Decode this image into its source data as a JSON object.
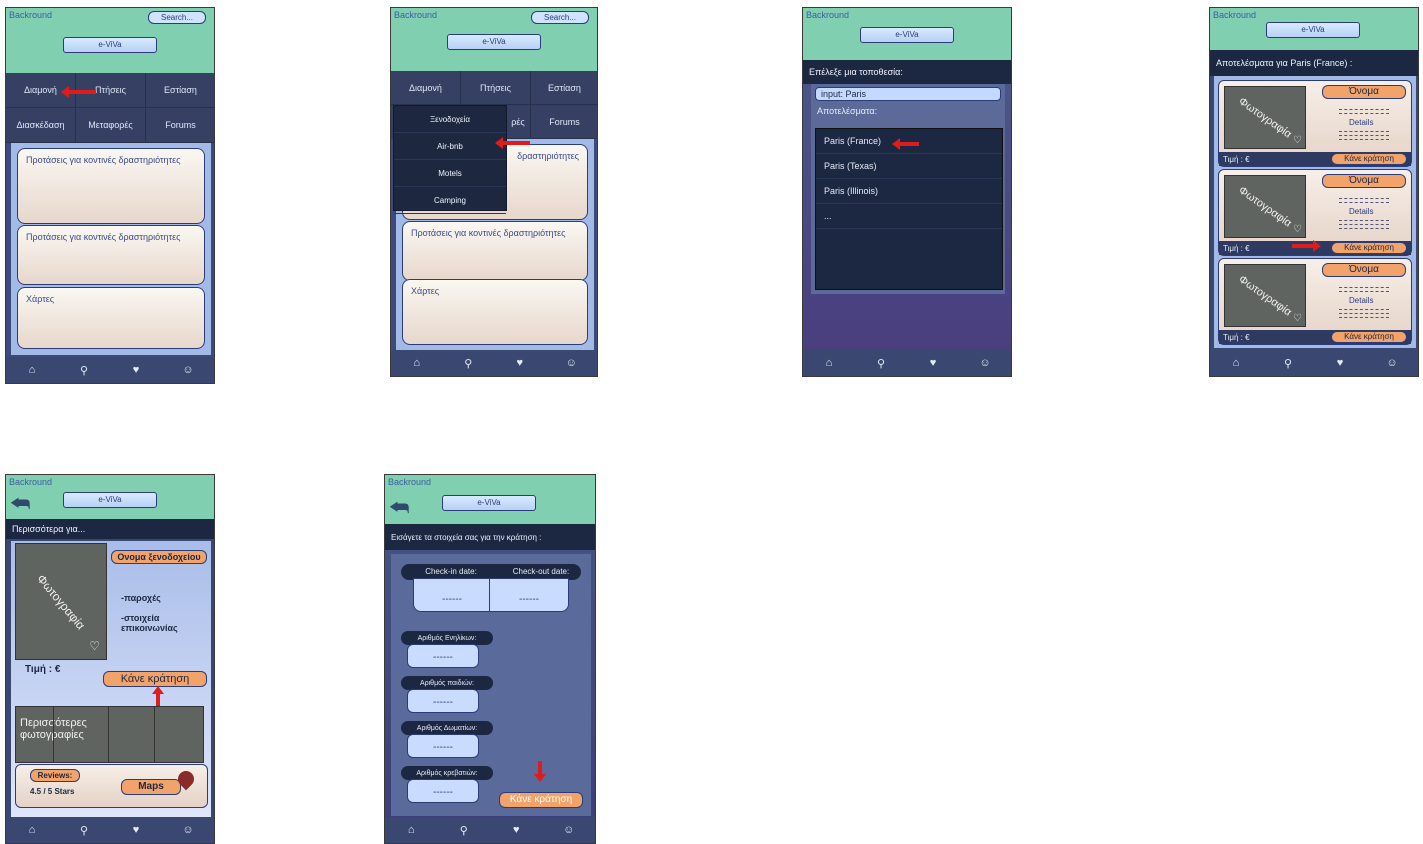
{
  "common": {
    "backround": "Backround",
    "search": "Search...",
    "logo": "e-ViVa",
    "nav_icons": [
      "home-icon",
      "search-icon",
      "heart-icon",
      "user-icon"
    ]
  },
  "screen1": {
    "nav": [
      "Διαμονή",
      "Πτήσεις",
      "Εστίαση",
      "Διασκέδαση",
      "Μεταφορές",
      "Forums"
    ],
    "cards": [
      "Προτάσεις για κοντινές δραστηριότητες",
      "Προτάσεις για κοντινές δραστηριότητες",
      "Χάρτες"
    ]
  },
  "screen2": {
    "nav": [
      "Διαμονή",
      "Πτήσεις",
      "Εστίαση",
      "Διασκέδαση",
      "Μεταφορές",
      "Forums"
    ],
    "menu": [
      "Ξενοδοχεία",
      "Air-bnb",
      "Motels",
      "Camping"
    ],
    "cards": [
      "Προτάσεις για κοντινές δραστηριότητες",
      "Προτάσεις για κοντινές δραστηριότητες",
      "Χάρτες"
    ],
    "partial_label": "δραστηριότητες",
    "partial_nav": "ρές"
  },
  "screen3": {
    "header": "Επέλεξε μια τοποθεσία:",
    "input": "input: Paris",
    "results_label": "Αποτελέσματα:",
    "results": [
      "Paris (France)",
      "Paris (Texas)",
      "Paris (Illinois)",
      "..."
    ]
  },
  "screen4": {
    "header": "Αποτελέσματα για Paris (France) :",
    "photo": "Φωτογραφία",
    "name": "Όνομα",
    "details": "Details",
    "price": "Τιμή : €",
    "book": "Κάνε κράτηση"
  },
  "screen5": {
    "header": "Περισσότερα για...",
    "photo": "Φωτογραφία",
    "hotel_name": "Ονομα ξενοδοχείου",
    "amenities": "-παροχές",
    "contact": "-στοιχεία επικοινωνίας",
    "price": "Τιμή : €",
    "book": "Κάνε κράτηση",
    "more_photos": "Περισσότερες φωτογραφίες",
    "reviews": "Reviews:",
    "stars": "4.5 / 5 Stars",
    "maps": "Maps"
  },
  "screen6": {
    "header": "Εισάγετε τα στοιχεία σας για την κράτηση :",
    "checkin": "Check-in date:",
    "checkout": "Check-out date:",
    "dashes": "------",
    "adults": "Αριθμός Ενηλίκων:",
    "children": "Αριθμός παιδιών:",
    "rooms": "Αριθμός Δωματίων:",
    "beds": "Αριθμός κρεβατιών:",
    "book": "Κάνε κράτηση"
  }
}
